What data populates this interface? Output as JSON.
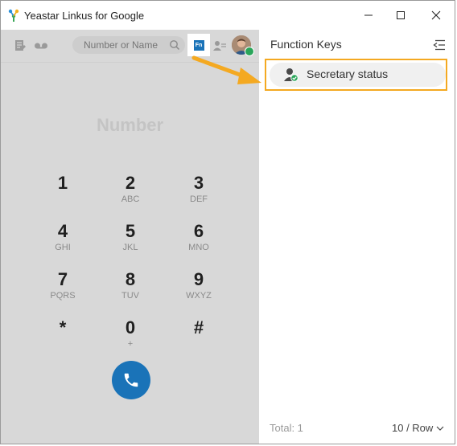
{
  "window": {
    "title": "Yeastar Linkus for Google",
    "controls": [
      "minimize",
      "maximize",
      "close"
    ]
  },
  "toolbar": {
    "search_placeholder": "Number or Name",
    "fn_label": "Fn",
    "icons": [
      "notes-icon",
      "voicemail-icon",
      "search-icon",
      "function-keys-icon",
      "contact-transfer-icon",
      "avatar"
    ]
  },
  "dialer": {
    "display_placeholder": "Number",
    "keys": [
      {
        "digit": "1",
        "letters": ""
      },
      {
        "digit": "2",
        "letters": "ABC"
      },
      {
        "digit": "3",
        "letters": "DEF"
      },
      {
        "digit": "4",
        "letters": "GHI"
      },
      {
        "digit": "5",
        "letters": "JKL"
      },
      {
        "digit": "6",
        "letters": "MNO"
      },
      {
        "digit": "7",
        "letters": "PQRS"
      },
      {
        "digit": "8",
        "letters": "TUV"
      },
      {
        "digit": "9",
        "letters": "WXYZ"
      },
      {
        "digit": "*",
        "letters": ""
      },
      {
        "digit": "0",
        "letters": "+"
      },
      {
        "digit": "#",
        "letters": ""
      }
    ]
  },
  "function_keys": {
    "title": "Function Keys",
    "items": [
      {
        "label": "Secretary status",
        "icon": "secretary-status-icon"
      }
    ],
    "total": "Total: 1",
    "per_page": "10 / Row"
  },
  "colors": {
    "accent": "#1a73b8",
    "highlight": "#f4a921",
    "status_green": "#2aa55a"
  }
}
